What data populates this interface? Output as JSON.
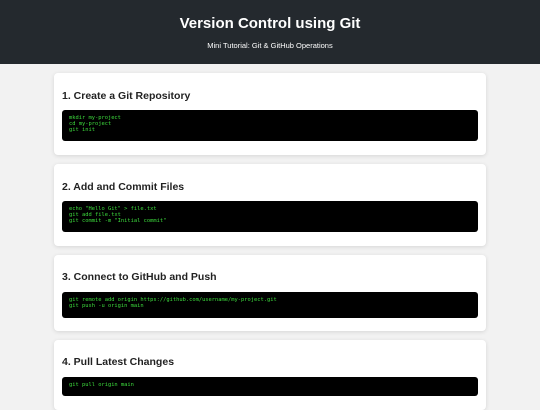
{
  "header": {
    "title": "Version Control using Git",
    "subtitle": "Mini Tutorial: Git & GitHub Operations"
  },
  "steps": [
    {
      "title": "1. Create a Git Repository",
      "code": [
        "mkdir my-project",
        "cd my-project",
        "git init"
      ]
    },
    {
      "title": "2. Add and Commit Files",
      "code": [
        "echo \"Hello Git\" > file.txt",
        "git add file.txt",
        "git commit -m \"Initial commit\""
      ]
    },
    {
      "title": "3. Connect to GitHub and Push",
      "code": [
        "git remote add origin https://github.com/username/my-project.git",
        "git push -u origin main"
      ]
    },
    {
      "title": "4. Pull Latest Changes",
      "code": [
        "git pull origin main"
      ]
    }
  ],
  "colors": {
    "header_bg": "#24292e",
    "page_bg": "#f2f2f2",
    "code_bg": "#000000",
    "code_text": "#3ddc3d"
  }
}
